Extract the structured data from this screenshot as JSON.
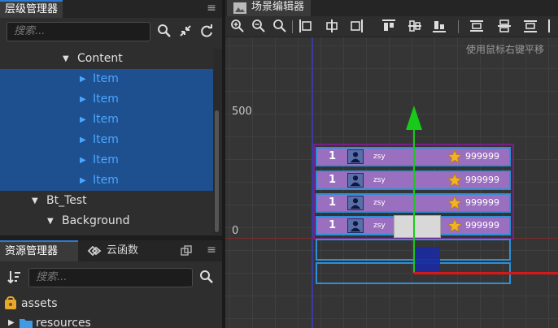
{
  "hierarchy": {
    "tab_label": "层级管理器",
    "search_placeholder": "搜索...",
    "nodes": [
      {
        "label": "Content",
        "expanded": true,
        "selected": false
      },
      {
        "label": "Item",
        "expanded": false,
        "selected": true
      },
      {
        "label": "Item",
        "expanded": false,
        "selected": true
      },
      {
        "label": "Item",
        "expanded": false,
        "selected": true
      },
      {
        "label": "Item",
        "expanded": false,
        "selected": true
      },
      {
        "label": "Item",
        "expanded": false,
        "selected": true
      },
      {
        "label": "Item",
        "expanded": false,
        "selected": true
      },
      {
        "label": "Bt_Test",
        "expanded": true,
        "selected": false
      },
      {
        "label": "Background",
        "expanded": true,
        "selected": false
      }
    ]
  },
  "assets_panel": {
    "tab_label": "资源管理器",
    "cloud_tab_label": "云函数",
    "search_placeholder": "搜索...",
    "items": [
      {
        "label": "assets"
      },
      {
        "label": "resources"
      }
    ]
  },
  "scene": {
    "tab_label": "场景编辑器",
    "hint": "使用鼠标右键平移",
    "ruler_500": "500",
    "ruler_0": "0",
    "rows": [
      {
        "rank": "1",
        "name": "zsy",
        "score": "999999"
      },
      {
        "rank": "1",
        "name": "zsy",
        "score": "999999"
      },
      {
        "rank": "1",
        "name": "zsy",
        "score": "999999"
      },
      {
        "rank": "1",
        "name": "zsy",
        "score": "999999"
      }
    ]
  },
  "colors": {
    "selection": "#1e4f8f",
    "selected_text": "#4aa6ff",
    "item_bg": "#9b6fc0",
    "gizmo_y": "#19c919",
    "gizmo_x": "#d81818"
  }
}
